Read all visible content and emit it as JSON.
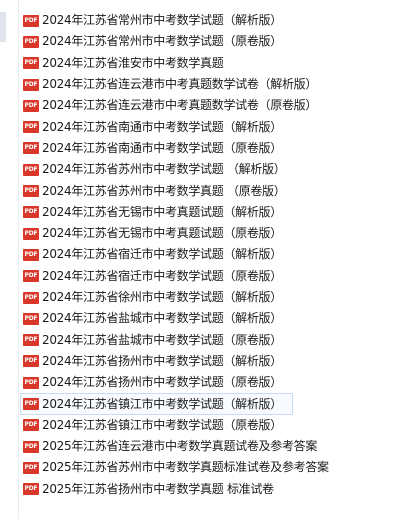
{
  "icons": {
    "pdf_icon_text": "PDF",
    "pdf_icon_color": "#d8372a"
  },
  "files": [
    {
      "name": "2024年江苏省常州市中考数学试题（解析版）"
    },
    {
      "name": "2024年江苏省常州市中考数学试题（原卷版）"
    },
    {
      "name": "2024年江苏省淮安市中考数学真题"
    },
    {
      "name": "2024年江苏省连云港市中考真题数学试卷（解析版）"
    },
    {
      "name": "2024年江苏省连云港市中考真题数学试卷（原卷版）"
    },
    {
      "name": "2024年江苏省南通市中考数学试题（解析版）"
    },
    {
      "name": "2024年江苏省南通市中考数学试题（原卷版）"
    },
    {
      "name": "2024年江苏省苏州市中考数学试题 （解析版）"
    },
    {
      "name": "2024年江苏省苏州市中考数学真题 （原卷版）"
    },
    {
      "name": "2024年江苏省无锡市中考真题试题（解析版）"
    },
    {
      "name": "2024年江苏省无锡市中考真题试题（原卷版）"
    },
    {
      "name": "2024年江苏省宿迁市中考数学试题（解析版）"
    },
    {
      "name": "2024年江苏省宿迁市中考数学试题（原卷版）"
    },
    {
      "name": "2024年江苏省徐州市中考数学试题（解析版）"
    },
    {
      "name": "2024年江苏省盐城市中考数学试题（解析版）"
    },
    {
      "name": "2024年江苏省盐城市中考数学试题（原卷版）"
    },
    {
      "name": "2024年江苏省扬州市中考数学试题（解析版）"
    },
    {
      "name": "2024年江苏省扬州市中考数学试题（原卷版）"
    },
    {
      "name": "2024年江苏省镇江市中考数学试题（解析版）",
      "selected": true
    },
    {
      "name": "2024年江苏省镇江市中考数学试题（原卷版）"
    },
    {
      "name": "2025年江苏省连云港市中考数学真题试卷及参考答案"
    },
    {
      "name": "2025年江苏省苏州市中考数学真题标准试卷及参考答案"
    },
    {
      "name": "2025年江苏省扬州市中考数学真题 标准试卷"
    }
  ]
}
